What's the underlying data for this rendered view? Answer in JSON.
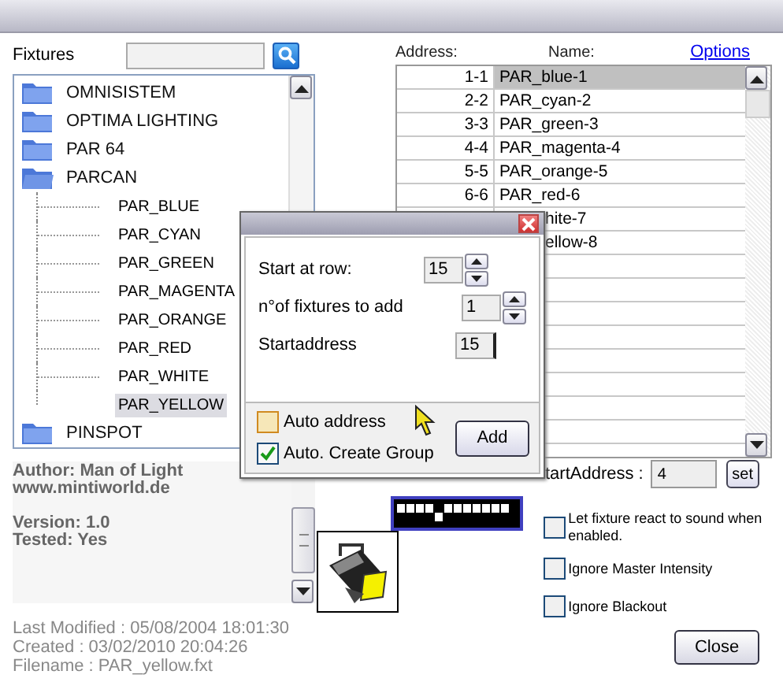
{
  "fixtures": {
    "label": "Fixtures",
    "tree": [
      {
        "name": "OMNISISTEM",
        "selected": false
      },
      {
        "name": "OPTIMA LIGHTING",
        "selected": false
      },
      {
        "name": "PAR 64",
        "selected": false
      },
      {
        "name": "PARCAN",
        "expanded": true,
        "selected": false,
        "children": [
          {
            "name": "PAR_BLUE",
            "selected": false
          },
          {
            "name": "PAR_CYAN",
            "selected": false
          },
          {
            "name": "PAR_GREEN",
            "selected": false
          },
          {
            "name": "PAR_MAGENTA",
            "selected": false
          },
          {
            "name": "PAR_ORANGE",
            "selected": false
          },
          {
            "name": "PAR_RED",
            "selected": false
          },
          {
            "name": "PAR_WHITE",
            "selected": false
          },
          {
            "name": "PAR_YELLOW",
            "selected": true
          }
        ]
      },
      {
        "name": "PINSPOT",
        "selected": false
      }
    ]
  },
  "info": {
    "groups": [
      [
        "Author: Man of Light",
        "www.mintiworld.de"
      ],
      [
        "Version: 1.0",
        "Tested: Yes"
      ]
    ],
    "meta": [
      "Last Modified : 05/08/2004 18:01:30",
      "Created : 03/02/2010 20:04:26",
      "Filename : PAR_yellow.fxt"
    ]
  },
  "patch": {
    "address_header": "Address:",
    "name_header": "Name:",
    "options_link": "Options",
    "rows": [
      {
        "address": "1-1",
        "name": "PAR_blue-1",
        "selected": true
      },
      {
        "address": "2-2",
        "name": "PAR_cyan-2",
        "selected": false
      },
      {
        "address": "3-3",
        "name": "PAR_green-3",
        "selected": false
      },
      {
        "address": "4-4",
        "name": "PAR_magenta-4",
        "selected": false
      },
      {
        "address": "5-5",
        "name": "PAR_orange-5",
        "selected": false
      },
      {
        "address": "6-6",
        "name": "PAR_red-6",
        "selected": false
      },
      {
        "address": "",
        "name": "hite-7",
        "selected": false,
        "kind": "partial"
      },
      {
        "address": "",
        "name": "ellow-8",
        "selected": false,
        "kind": "partial"
      }
    ],
    "start_address_label": "tartAddress :",
    "start_address_value": "4",
    "set_button": "set",
    "bits": [
      {
        "on": false
      },
      {
        "on": false
      },
      {
        "on": false
      },
      {
        "on": false
      },
      {
        "on": true
      },
      {
        "on": false
      },
      {
        "on": false
      },
      {
        "on": false
      },
      {
        "on": false
      },
      {
        "on": false
      },
      {
        "on": false
      },
      {
        "on": false
      }
    ],
    "options": [
      {
        "label": "Let fixture react to sound when enabled.",
        "checked": false
      },
      {
        "label": "Ignore Master Intensity",
        "checked": false
      },
      {
        "label": "Ignore Blackout",
        "checked": false
      }
    ],
    "close_button": "Close"
  },
  "dialog": {
    "fields": [
      {
        "label": "Start at row:",
        "value": "15",
        "kind": "spin"
      },
      {
        "label": "n°of fixtures to add",
        "value": "1",
        "kind": "spin"
      },
      {
        "label": "Startaddress",
        "value": "15",
        "kind": "text"
      }
    ],
    "checks": [
      {
        "label": "Auto address",
        "checked": false
      },
      {
        "label": "Auto. Create Group",
        "checked": true
      }
    ],
    "add_button": "Add"
  }
}
